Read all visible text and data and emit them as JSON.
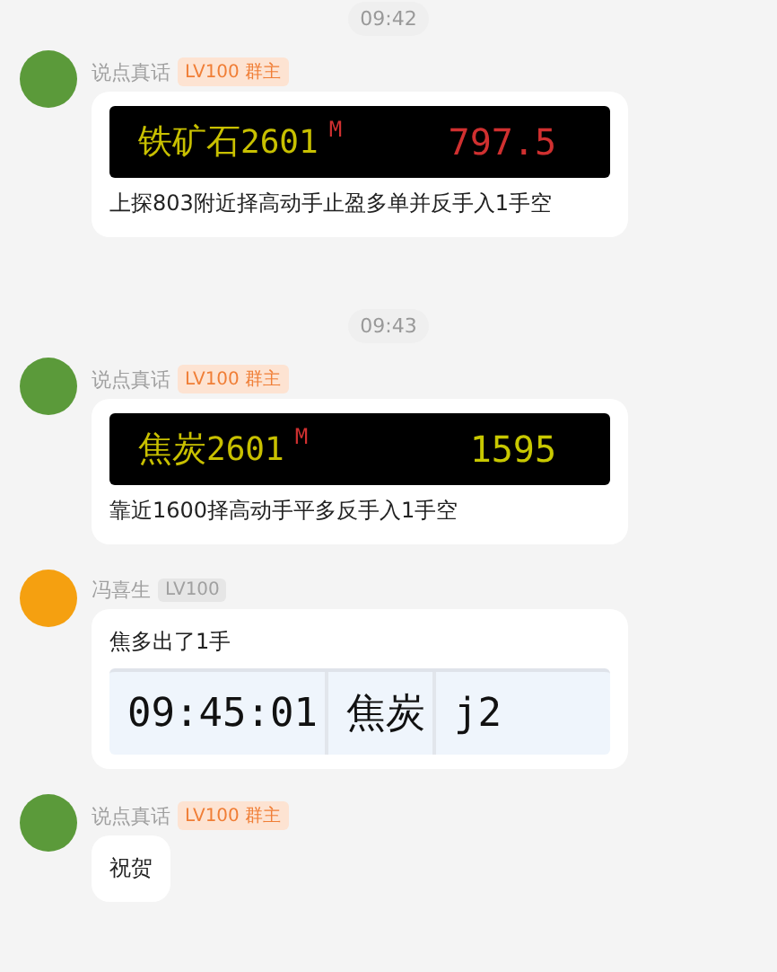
{
  "messages": [
    {
      "kind": "time",
      "text": "09:42"
    },
    {
      "kind": "message",
      "sender": "说点真话",
      "color": "#5b9a3a",
      "badge": {
        "kind": "owner",
        "text": "LV100 群主"
      },
      "content": [
        {
          "kind": "quote-bar",
          "name": "铁矿石",
          "code": "2601",
          "flag": "M",
          "price": "797.5",
          "color": "#d03030"
        },
        {
          "kind": "text",
          "text": "上探803附近择高动手止盈多单并反手入1手空"
        }
      ]
    },
    {
      "kind": "time",
      "text": "09:43"
    },
    {
      "kind": "message",
      "sender": "说点真话",
      "color": "#5b9a3a",
      "badge": {
        "kind": "owner",
        "text": "LV100 群主"
      },
      "content": [
        {
          "kind": "quote-bar",
          "name": "焦炭",
          "code": "2601",
          "flag": "M",
          "price": "1595",
          "color": "#c8c800"
        },
        {
          "kind": "text",
          "text": "靠近1600择高动手平多反手入1手空"
        }
      ]
    },
    {
      "kind": "message",
      "sender": "冯喜生",
      "color": "#f5a010",
      "badge": {
        "kind": "member",
        "text": "LV100"
      },
      "content": [
        {
          "kind": "text",
          "text": "焦多出了1手"
        },
        {
          "kind": "quote-table",
          "cells": [
            "09:45:01",
            "焦炭",
            "j2"
          ]
        }
      ]
    },
    {
      "kind": "message",
      "sender": "说点真话",
      "color": "#5b9a3a",
      "badge": {
        "kind": "owner",
        "text": "LV100 群主"
      },
      "content": [
        {
          "kind": "text",
          "text": "祝贺"
        }
      ]
    }
  ]
}
